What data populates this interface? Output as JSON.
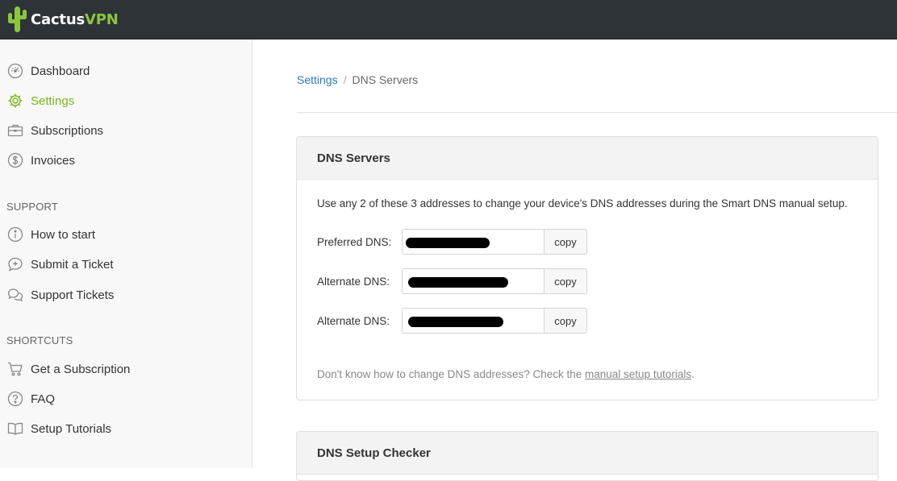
{
  "brand": {
    "name_part1": "Cactus",
    "name_part2": "VPN",
    "accent": "#8cc63f"
  },
  "sidebar": {
    "items": [
      {
        "label": "Dashboard",
        "icon": "dashboard-gauge-icon"
      },
      {
        "label": "Settings",
        "icon": "gear-icon",
        "active": true
      },
      {
        "label": "Subscriptions",
        "icon": "briefcase-icon"
      },
      {
        "label": "Invoices",
        "icon": "dollar-circle-icon"
      }
    ],
    "support_heading": "SUPPORT",
    "support_items": [
      {
        "label": "How to start",
        "icon": "info-circle-icon"
      },
      {
        "label": "Submit a Ticket",
        "icon": "chat-plus-icon"
      },
      {
        "label": "Support Tickets",
        "icon": "chat-bubbles-icon"
      }
    ],
    "shortcuts_heading": "SHORTCUTS",
    "shortcut_items": [
      {
        "label": "Get a Subscription",
        "icon": "cart-icon"
      },
      {
        "label": "FAQ",
        "icon": "question-circle-icon"
      },
      {
        "label": "Setup Tutorials",
        "icon": "book-icon"
      }
    ]
  },
  "breadcrumb": {
    "parent": "Settings",
    "separator": "/",
    "current": "DNS Servers"
  },
  "dns_panel": {
    "title": "DNS Servers",
    "intro": "Use any 2 of these 3 addresses to change your device's DNS addresses during the Smart DNS manual setup.",
    "rows": [
      {
        "label": "Preferred DNS:",
        "value_redacted": true,
        "copy_label": "copy"
      },
      {
        "label": "Alternate DNS:",
        "value_redacted": true,
        "copy_label": "copy"
      },
      {
        "label": "Alternate DNS:",
        "value_redacted": true,
        "copy_label": "copy"
      }
    ],
    "footnote_prefix": "Don't know how to change DNS addresses? Check the ",
    "footnote_link": "manual setup tutorials",
    "footnote_suffix": "."
  },
  "checker_panel": {
    "title": "DNS Setup Checker"
  }
}
